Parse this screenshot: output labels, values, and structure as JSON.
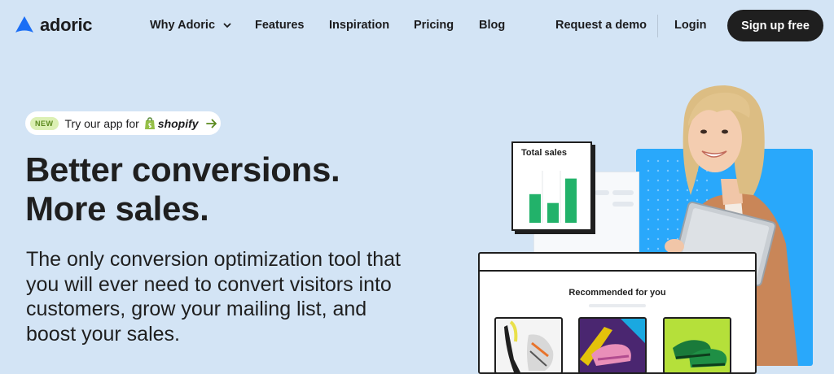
{
  "brand": {
    "name": "adoric",
    "color": "#1a6ef5"
  },
  "nav": {
    "why": "Why Adoric",
    "features": "Features",
    "inspiration": "Inspiration",
    "pricing": "Pricing",
    "blog": "Blog",
    "demo": "Request a demo",
    "login": "Login",
    "signup": "Sign up free"
  },
  "promo": {
    "badge": "NEW",
    "text": "Try our app for",
    "partner": "shopify"
  },
  "hero": {
    "headline_1": "Better conversions.",
    "headline_2": "More sales.",
    "subtext": "The only conversion optimization tool that you will ever need to convert visitors into customers, grow your mailing list, and boost your sales."
  },
  "illustration": {
    "chart_title": "Total sales",
    "bar_levels": [
      0.55,
      0.38,
      0.85
    ],
    "bar_color": "#22b26a",
    "recommended_title": "Recommended for you"
  }
}
